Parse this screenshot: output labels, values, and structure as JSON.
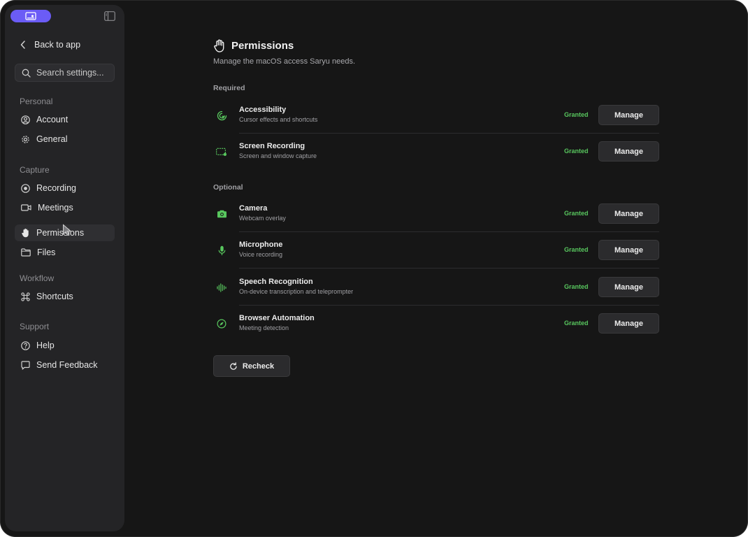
{
  "sidebar": {
    "back_label": "Back to app",
    "search_placeholder": "Search settings...",
    "sections": {
      "personal": "Personal",
      "capture": "Capture",
      "workflow": "Workflow",
      "support": "Support"
    },
    "items": {
      "account": "Account",
      "general": "General",
      "recording": "Recording",
      "meetings": "Meetings",
      "permissions": "Permissions",
      "files": "Files",
      "shortcuts": "Shortcuts",
      "help": "Help",
      "feedback": "Send Feedback"
    },
    "active_item": "permissions",
    "accent_color": "#6b5cf6"
  },
  "main": {
    "title": "Permissions",
    "subtitle": "Manage the macOS access Saryu needs.",
    "required_label": "Required",
    "optional_label": "Optional",
    "manage_label": "Manage",
    "recheck_label": "Recheck",
    "status_color": "#58c75e",
    "required": [
      {
        "name": "Accessibility",
        "desc": "Cursor effects and shortcuts",
        "status": "Granted",
        "icon": "accessibility-icon"
      },
      {
        "name": "Screen Recording",
        "desc": "Screen and window capture",
        "status": "Granted",
        "icon": "screen-recording-icon"
      }
    ],
    "optional": [
      {
        "name": "Camera",
        "desc": "Webcam overlay",
        "status": "Granted",
        "icon": "camera-icon"
      },
      {
        "name": "Microphone",
        "desc": "Voice recording",
        "status": "Granted",
        "icon": "microphone-icon"
      },
      {
        "name": "Speech Recognition",
        "desc": "On-device transcription and teleprompter",
        "status": "Granted",
        "icon": "waveform-icon"
      },
      {
        "name": "Browser Automation",
        "desc": "Meeting detection",
        "status": "Granted",
        "icon": "compass-icon"
      }
    ]
  }
}
